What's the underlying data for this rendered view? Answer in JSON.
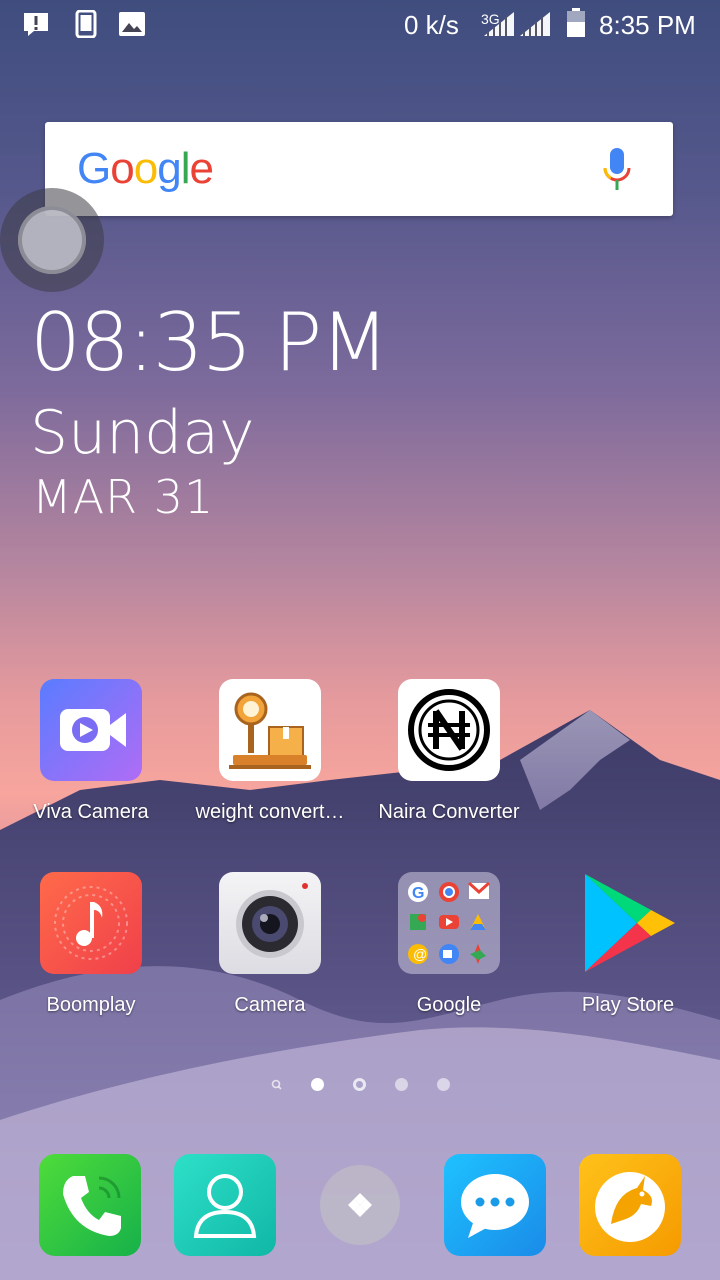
{
  "status_bar": {
    "net_speed": "0 k/s",
    "network_type": "3G",
    "time": "8:35 PM",
    "icons": [
      "alert-notification-icon",
      "phone-device-icon",
      "image-icon",
      "signal-icon",
      "battery-icon"
    ]
  },
  "search": {
    "logo": "Google",
    "mic_icon": "microphone-icon"
  },
  "clock_widget": {
    "time": "08:35 PM",
    "day": "Sunday",
    "date": "MAR 31"
  },
  "apps": [
    {
      "label": "Viva Camera",
      "icon": "viva-camera-icon"
    },
    {
      "label": "weight convert…",
      "icon": "weight-scale-icon"
    },
    {
      "label": "Naira Converter",
      "icon": "naira-icon"
    },
    {
      "label": "Boomplay",
      "icon": "music-note-icon"
    },
    {
      "label": "Camera",
      "icon": "camera-lens-icon"
    },
    {
      "label": "Google",
      "icon": "google-folder-icon"
    },
    {
      "label": "Play Store",
      "icon": "play-store-icon"
    }
  ],
  "page_indicator": {
    "pages": 4,
    "current": 1
  },
  "dock": [
    "phone-icon",
    "contacts-icon",
    "app-drawer-icon",
    "messaging-icon",
    "browser-icon"
  ],
  "colors": {
    "google_blue": "#4285F4",
    "google_red": "#EA4335",
    "google_yellow": "#FBBC05",
    "google_green": "#34A853"
  }
}
